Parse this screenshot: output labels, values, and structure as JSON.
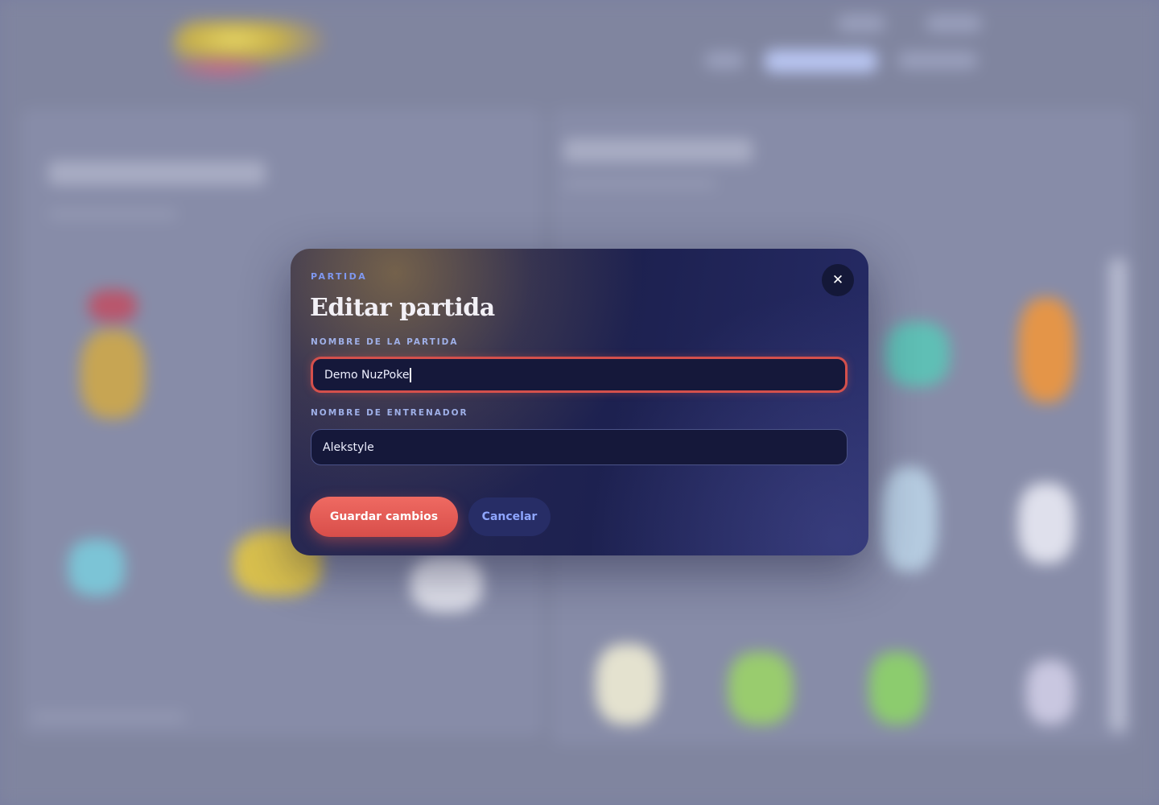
{
  "modal": {
    "eyebrow": "PARTIDA",
    "title": "Editar partida",
    "close_icon": "close-icon",
    "fields": [
      {
        "label": "NOMBRE DE LA PARTIDA",
        "value": "Demo NuzPoke",
        "focused": true
      },
      {
        "label": "NOMBRE DE ENTRENADOR",
        "value": "Alekstyle",
        "focused": false
      }
    ],
    "save_label": "Guardar cambios",
    "cancel_label": "Cancelar"
  },
  "colors": {
    "accent": "#d84e4a",
    "eyebrow": "#7f98f0",
    "modal_bg": "#1d2150",
    "cancel_text": "#8fa6ff"
  }
}
